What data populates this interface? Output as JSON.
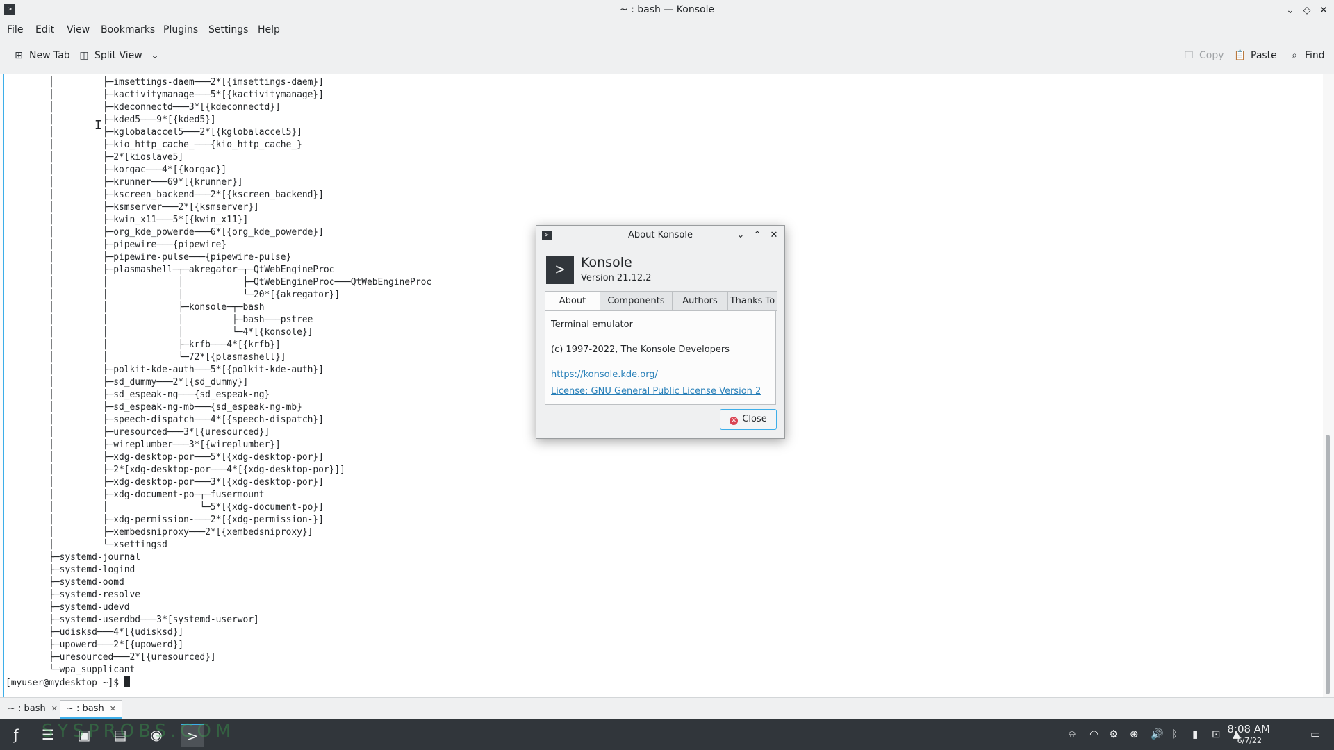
{
  "window": {
    "title": "~ : bash — Konsole"
  },
  "menubar": [
    "File",
    "Edit",
    "View",
    "Bookmarks",
    "Plugins",
    "Settings",
    "Help"
  ],
  "toolbar": {
    "new_tab": "New Tab",
    "split_view": "Split View",
    "copy": "Copy",
    "paste": "Paste",
    "find": "Find"
  },
  "terminal": {
    "lines": [
      "        │         ├─imsettings-daem───2*[{imsettings-daem}]",
      "        │         ├─kactivitymanage───5*[{kactivitymanage}]",
      "        │         ├─kdeconnectd───3*[{kdeconnectd}]",
      "        │         ├─kded5───9*[{kded5}]",
      "        │         ├─kglobalaccel5───2*[{kglobalaccel5}]",
      "        │         ├─kio_http_cache_───{kio_http_cache_}",
      "        │         ├─2*[kioslave5]",
      "        │         ├─korgac───4*[{korgac}]",
      "        │         ├─krunner───69*[{krunner}]",
      "        │         ├─kscreen_backend───2*[{kscreen_backend}]",
      "        │         ├─ksmserver───2*[{ksmserver}]",
      "        │         ├─kwin_x11───5*[{kwin_x11}]",
      "        │         ├─org_kde_powerde───6*[{org_kde_powerde}]",
      "        │         ├─pipewire───{pipewire}",
      "        │         ├─pipewire-pulse───{pipewire-pulse}",
      "        │         ├─plasmashell─┬─akregator─┬─QtWebEngineProc",
      "        │         │             │           ├─QtWebEngineProc───QtWebEngineProc",
      "        │         │             │           └─20*[{akregator}]",
      "        │         │             ├─konsole─┬─bash",
      "        │         │             │         ├─bash───pstree",
      "        │         │             │         └─4*[{konsole}]",
      "        │         │             ├─krfb───4*[{krfb}]",
      "        │         │             └─72*[{plasmashell}]",
      "        │         ├─polkit-kde-auth───5*[{polkit-kde-auth}]",
      "        │         ├─sd_dummy───2*[{sd_dummy}]",
      "        │         ├─sd_espeak-ng───{sd_espeak-ng}",
      "        │         ├─sd_espeak-ng-mb───{sd_espeak-ng-mb}",
      "        │         ├─speech-dispatch───4*[{speech-dispatch}]",
      "        │         ├─uresourced───3*[{uresourced}]",
      "        │         ├─wireplumber───3*[{wireplumber}]",
      "        │         ├─xdg-desktop-por───5*[{xdg-desktop-por}]",
      "        │         ├─2*[xdg-desktop-por───4*[{xdg-desktop-por}]]",
      "        │         ├─xdg-desktop-por───3*[{xdg-desktop-por}]",
      "        │         ├─xdg-document-po─┬─fusermount",
      "        │         │                 └─5*[{xdg-document-po}]",
      "        │         ├─xdg-permission-───2*[{xdg-permission-}]",
      "        │         ├─xembedsniproxy───2*[{xembedsniproxy}]",
      "        │         └─xsettingsd",
      "        ├─systemd-journal",
      "        ├─systemd-logind",
      "        ├─systemd-oomd",
      "        ├─systemd-resolve",
      "        ├─systemd-udevd",
      "        ├─systemd-userdbd───3*[systemd-userwor]",
      "        ├─udisksd───4*[{udisksd}]",
      "        ├─upowerd───2*[{upowerd}]",
      "        ├─uresourced───2*[{uresourced}]",
      "        └─wpa_supplicant"
    ],
    "prompt": "[myuser@mydesktop ~]$ "
  },
  "tabs": [
    {
      "label": "~ : bash",
      "active": false
    },
    {
      "label": "~ : bash",
      "active": true
    }
  ],
  "dialog": {
    "title": "About Konsole",
    "app_name": "Konsole",
    "version": "Version 21.12.2",
    "tabs": [
      "About",
      "Components",
      "Authors",
      "Thanks To"
    ],
    "description": "Terminal emulator",
    "copyright": "(c) 1997-2022, The Konsole Developers",
    "homepage": "https://konsole.kde.org/",
    "license": "License: GNU General Public License Version 2",
    "close_label": "Close"
  },
  "panel": {
    "time": "8:08 AM",
    "date": "6/7/22",
    "watermark": "SYSPROBS.COM"
  },
  "colors": {
    "accent": "#3daee9",
    "panel_bg": "#31363b",
    "link": "#2980b9",
    "close_icon": "#da4453"
  },
  "icons": [
    "konsole-icon",
    "minimize-icon",
    "maximize-icon",
    "close-icon",
    "new-tab-icon",
    "split-view-icon",
    "copy-icon",
    "paste-icon",
    "find-icon",
    "fedora-icon",
    "task-manager-icon",
    "store-icon",
    "file-manager-icon",
    "firefox-icon",
    "terminal-icon"
  ]
}
